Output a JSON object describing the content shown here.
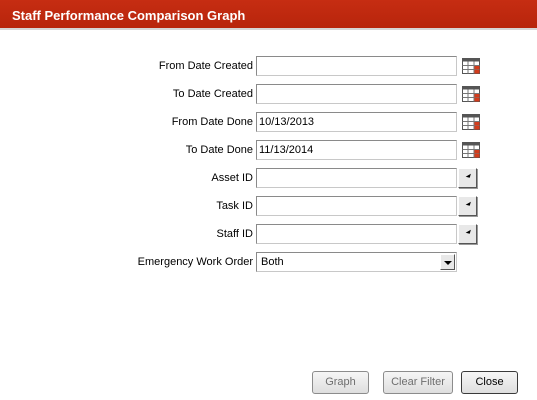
{
  "window": {
    "title": "Staff Performance Comparison Graph"
  },
  "form": {
    "from_date_created": {
      "label": "From Date Created",
      "value": ""
    },
    "to_date_created": {
      "label": "To Date Created",
      "value": ""
    },
    "from_date_done": {
      "label": "From Date Done",
      "value": "10/13/2013"
    },
    "to_date_done": {
      "label": "To Date Done",
      "value": "11/13/2014"
    },
    "asset_id": {
      "label": "Asset ID",
      "value": ""
    },
    "task_id": {
      "label": "Task ID",
      "value": ""
    },
    "staff_id": {
      "label": "Staff ID",
      "value": ""
    },
    "emergency_work_order": {
      "label": "Emergency Work Order",
      "selected": "Both"
    }
  },
  "buttons": {
    "graph": "Graph",
    "clear_filter": "Clear Filter",
    "close": "Close"
  },
  "icons": {
    "calendar": "calendar-icon",
    "lookup": "lookup-arrow-icon",
    "dropdown": "chevron-down-icon"
  },
  "colors": {
    "titlebar": "#c0280e",
    "calendar_accent": "#d23c1c"
  }
}
